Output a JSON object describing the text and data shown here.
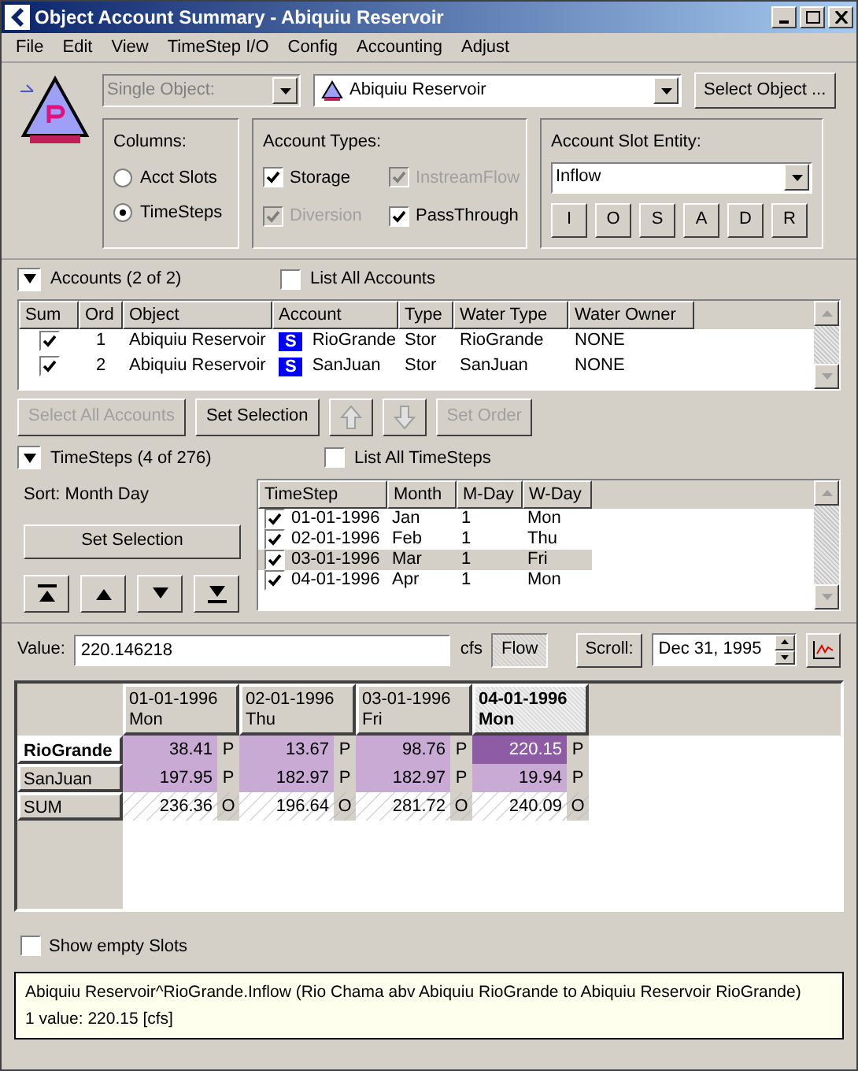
{
  "window": {
    "title": "Object Account Summary - Abiquiu Reservoir"
  },
  "menu": [
    "File",
    "Edit",
    "View",
    "TimeStep I/O",
    "Config",
    "Accounting",
    "Adjust"
  ],
  "object_bar": {
    "mode": {
      "value": "Single Object:",
      "disabled": true
    },
    "object": {
      "value": "Abiquiu Reservoir"
    },
    "select_button": "Select Object ..."
  },
  "columns_box": {
    "label": "Columns:",
    "options": [
      {
        "label": "Acct Slots",
        "selected": false
      },
      {
        "label": "TimeSteps",
        "selected": true
      }
    ]
  },
  "account_types": {
    "label": "Account Types:",
    "items": [
      {
        "label": "Storage",
        "checked": true,
        "disabled": false
      },
      {
        "label": "InstreamFlow",
        "checked": true,
        "disabled": true
      },
      {
        "label": "Diversion",
        "checked": true,
        "disabled": true
      },
      {
        "label": "PassThrough",
        "checked": true,
        "disabled": false
      }
    ]
  },
  "slot_entity": {
    "label": "Account Slot Entity:",
    "value": "Inflow",
    "buttons": [
      "I",
      "O",
      "S",
      "A",
      "D",
      "R"
    ]
  },
  "accounts": {
    "expanded": true,
    "label": "Accounts (2 of 2)",
    "list_all": {
      "label": "List All Accounts",
      "checked": false
    },
    "columns": [
      "Sum",
      "Ord",
      "Object",
      "Account",
      "Type",
      "Water Type",
      "Water Owner"
    ],
    "rows": [
      {
        "sum": true,
        "ord": "1",
        "object": "Abiquiu Reservoir",
        "badge": "S",
        "account": "RioGrande",
        "type": "Stor",
        "water_type": "RioGrande",
        "water_owner": "NONE"
      },
      {
        "sum": true,
        "ord": "2",
        "object": "Abiquiu Reservoir",
        "badge": "S",
        "account": "SanJuan",
        "type": "Stor",
        "water_type": "SanJuan",
        "water_owner": "NONE"
      }
    ],
    "buttons": [
      {
        "kind": "text",
        "label": "Select All Accounts",
        "disabled": true
      },
      {
        "kind": "text",
        "label": "Set Selection",
        "disabled": false
      },
      {
        "kind": "up",
        "disabled": true
      },
      {
        "kind": "down",
        "disabled": true
      },
      {
        "kind": "text",
        "label": "Set Order",
        "disabled": true
      }
    ]
  },
  "timesteps": {
    "expanded": true,
    "label": "TimeSteps (4 of 276)",
    "list_all": {
      "label": "List All TimeSteps",
      "checked": false
    },
    "sort_label": "Sort: Month Day",
    "set_selection": "Set Selection",
    "nav_buttons": [
      {
        "kind": "top"
      },
      {
        "kind": "up"
      },
      {
        "kind": "down"
      },
      {
        "kind": "bottom"
      }
    ],
    "columns": [
      "TimeStep",
      "Month",
      "M-Day",
      "W-Day"
    ],
    "rows": [
      {
        "checked": true,
        "timestep": "01-01-1996",
        "month": "Jan",
        "mday": "1",
        "wday": "Mon",
        "selected": false
      },
      {
        "checked": true,
        "timestep": "02-01-1996",
        "month": "Feb",
        "mday": "1",
        "wday": "Thu",
        "selected": false
      },
      {
        "checked": true,
        "timestep": "03-01-1996",
        "month": "Mar",
        "mday": "1",
        "wday": "Fri",
        "selected": true
      },
      {
        "checked": true,
        "timestep": "04-01-1996",
        "month": "Apr",
        "mday": "1",
        "wday": "Mon",
        "selected": false
      }
    ]
  },
  "value_bar": {
    "label": "Value:",
    "value": "220.146218",
    "unit": "cfs",
    "flow_button": "Flow",
    "scroll_label": "Scroll:",
    "scroll_date": "Dec 31, 1995"
  },
  "grid": {
    "columns": [
      {
        "date": "01-01-1996",
        "day": "Mon",
        "selected": false
      },
      {
        "date": "02-01-1996",
        "day": "Thu",
        "selected": false
      },
      {
        "date": "03-01-1996",
        "day": "Fri",
        "selected": false
      },
      {
        "date": "04-01-1996",
        "day": "Mon",
        "selected": true
      }
    ],
    "rows": [
      {
        "label": "RioGrande",
        "selected": true,
        "cells": [
          {
            "value": "38.41",
            "flag": "P",
            "kind": "input"
          },
          {
            "value": "13.67",
            "flag": "P",
            "kind": "input"
          },
          {
            "value": "98.76",
            "flag": "P",
            "kind": "input"
          },
          {
            "value": "220.15",
            "flag": "P",
            "kind": "selected"
          }
        ]
      },
      {
        "label": "SanJuan",
        "selected": false,
        "cells": [
          {
            "value": "197.95",
            "flag": "P",
            "kind": "input"
          },
          {
            "value": "182.97",
            "flag": "P",
            "kind": "input"
          },
          {
            "value": "182.97",
            "flag": "P",
            "kind": "input"
          },
          {
            "value": "19.94",
            "flag": "P",
            "kind": "input"
          }
        ]
      },
      {
        "label": "SUM",
        "selected": false,
        "cells": [
          {
            "value": "236.36",
            "flag": "O",
            "kind": "output"
          },
          {
            "value": "196.64",
            "flag": "O",
            "kind": "output"
          },
          {
            "value": "281.72",
            "flag": "O",
            "kind": "output"
          },
          {
            "value": "240.09",
            "flag": "O",
            "kind": "output"
          }
        ]
      }
    ]
  },
  "show_empty": {
    "label": "Show empty Slots",
    "checked": false
  },
  "status": [
    "Abiquiu Reservoir^RioGrande.Inflow (Rio Chama abv Abiquiu RioGrande to Abiquiu Reservoir RioGrande)",
    "1 value:  220.15 [cfs]"
  ]
}
